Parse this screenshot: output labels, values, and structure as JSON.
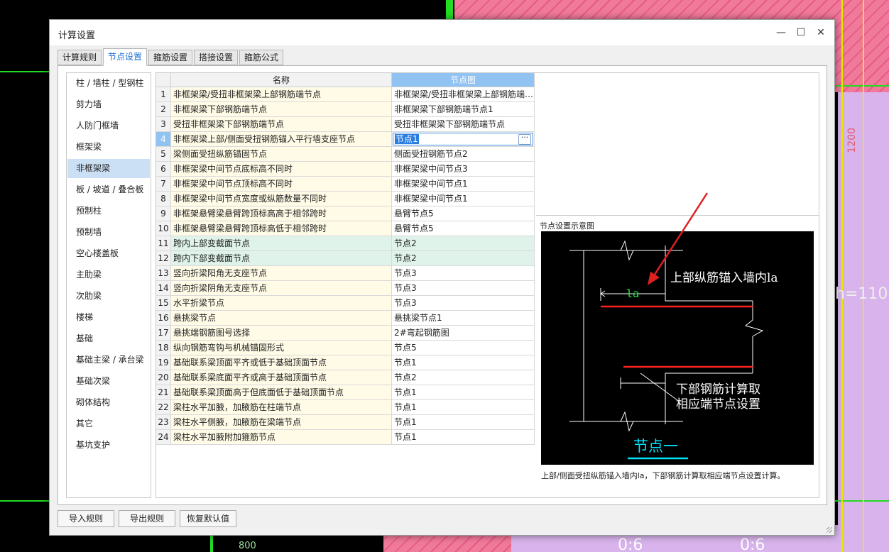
{
  "background": {
    "dimensions": [
      "1200",
      "800",
      "0:6",
      "0:6"
    ],
    "stray_text": "h=110"
  },
  "dialog": {
    "title": "计算设置",
    "controls": {
      "minimize": "—",
      "maximize": "☐",
      "close": "✕"
    }
  },
  "tabs": [
    {
      "label": "计算规则"
    },
    {
      "label": "节点设置",
      "active": true
    },
    {
      "label": "箍筋设置"
    },
    {
      "label": "搭接设置"
    },
    {
      "label": "箍筋公式"
    }
  ],
  "nav": {
    "selected": "非框架梁",
    "items": [
      "柱 / 墙柱 / 型钢柱",
      "剪力墙",
      "人防门框墙",
      "框架梁",
      "非框架梁",
      "板 / 坡道 / 叠合板",
      "预制柱",
      "预制墙",
      "空心楼盖板",
      "主肋梁",
      "次肋梁",
      "楼梯",
      "基础",
      "基础主梁 / 承台梁",
      "基础次梁",
      "砌体结构",
      "其它",
      "基坑支护"
    ]
  },
  "grid": {
    "columns": {
      "name": "名称",
      "node": "节点图"
    },
    "current_row": 4,
    "editing_value": "节点1",
    "ellipsis": "···",
    "rows": [
      {
        "num": "1",
        "name": "非框架梁/受扭非框架梁上部钢筋端节点",
        "node": "非框架梁/受扭非框架梁上部钢筋端节点"
      },
      {
        "num": "2",
        "name": "非框架梁下部钢筋端节点",
        "node": "非框架梁下部钢筋端节点1"
      },
      {
        "num": "3",
        "name": "受扭非框架梁下部钢筋端节点",
        "node": "受扭非框架梁下部钢筋端节点"
      },
      {
        "num": "4",
        "name": "非框架梁上部/侧面受扭钢筋锚入平行墙支座节点",
        "node": "节点1"
      },
      {
        "num": "5",
        "name": "梁侧面受扭纵筋锚固节点",
        "node": "侧面受扭钢筋节点2"
      },
      {
        "num": "6",
        "name": "非框架梁中间节点底标高不同时",
        "node": "非框架梁中间节点3"
      },
      {
        "num": "7",
        "name": "非框架梁中间节点顶标高不同时",
        "node": "非框架梁中间节点1"
      },
      {
        "num": "8",
        "name": "非框架梁中间节点宽度或纵筋数量不同时",
        "node": "非框架梁中间节点1"
      },
      {
        "num": "9",
        "name": "非框架悬臂梁悬臂跨顶标高高于相邻跨时",
        "node": "悬臂节点5"
      },
      {
        "num": "10",
        "name": "非框架悬臂梁悬臂跨顶标高低于相邻跨时",
        "node": "悬臂节点5"
      },
      {
        "num": "11",
        "name": "跨内上部变截面节点",
        "node": "节点2",
        "hl": true
      },
      {
        "num": "12",
        "name": "跨内下部变截面节点",
        "node": "节点2",
        "hl": true
      },
      {
        "num": "13",
        "name": "竖向折梁阳角无支座节点",
        "node": "节点3"
      },
      {
        "num": "14",
        "name": "竖向折梁阴角无支座节点",
        "node": "节点3"
      },
      {
        "num": "15",
        "name": "水平折梁节点",
        "node": "节点3"
      },
      {
        "num": "16",
        "name": "悬挑梁节点",
        "node": "悬挑梁节点1"
      },
      {
        "num": "17",
        "name": "悬挑端钢筋图号选择",
        "node": "2#弯起钢筋图"
      },
      {
        "num": "18",
        "name": "纵向钢筋弯钩与机械锚固形式",
        "node": "节点5"
      },
      {
        "num": "19",
        "name": "基础联系梁顶面平齐或低于基础顶面节点",
        "node": "节点1"
      },
      {
        "num": "20",
        "name": "基础联系梁底面平齐或高于基础顶面节点",
        "node": "节点2"
      },
      {
        "num": "21",
        "name": "基础联系梁顶面高于但底面低于基础顶面节点",
        "node": "节点1"
      },
      {
        "num": "22",
        "name": "梁柱水平加腋，加腋筋在柱端节点",
        "node": "节点1"
      },
      {
        "num": "23",
        "name": "梁柱水平侧腋，加腋筋在梁端节点",
        "node": "节点1"
      },
      {
        "num": "24",
        "name": "梁柱水平加腋附加箍筋节点",
        "node": "节点1"
      }
    ]
  },
  "preview": {
    "title": "节点设置示意图",
    "diagram": {
      "label_top": "上部纵筋锚入墙内la",
      "label_la": "la",
      "label_bottom_1": "下部钢筋计算取",
      "label_bottom_2": "相应端节点设置",
      "caption": "节点一"
    },
    "description": "上部/侧面受扭纵筋锚入墙内la，下部钢筋计算取相应端节点设置计算。"
  },
  "buttons": {
    "import": "导入规则",
    "export": "导出规则",
    "restore": "恢复默认值"
  },
  "colors": {
    "accent": "#1b6fd3",
    "selected_header": "#90c2f2",
    "name_cell": "#fffbe6",
    "highlight_row": "#dff3ea",
    "rebar_red": "#ff2020",
    "callout_arrow": "#e02020",
    "caption_cyan": "#00e5ff"
  }
}
